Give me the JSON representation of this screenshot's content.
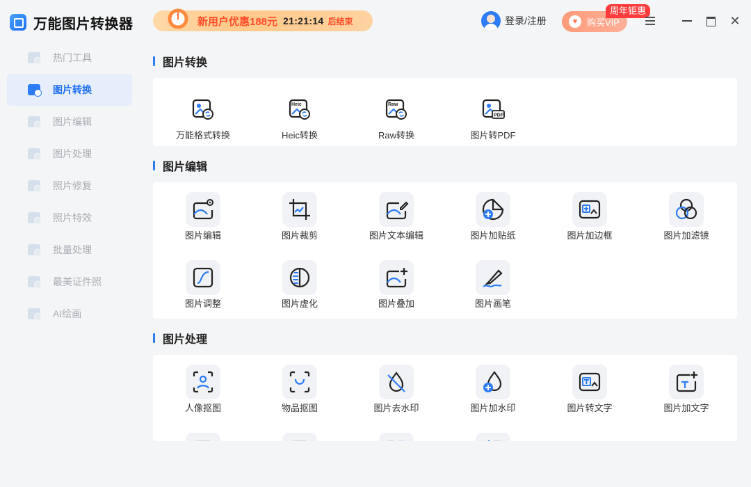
{
  "app": {
    "title": "万能图片转换器",
    "logo_icon": "app-logo-icon"
  },
  "sidebar": {
    "items": [
      {
        "label": "热门工具",
        "icon": "hot-tools-icon",
        "active": false
      },
      {
        "label": "图片转换",
        "icon": "image-convert-icon",
        "active": true
      },
      {
        "label": "图片编辑",
        "icon": "image-edit-icon",
        "active": false
      },
      {
        "label": "图片处理",
        "icon": "image-process-icon",
        "active": false
      },
      {
        "label": "照片修复",
        "icon": "photo-repair-icon",
        "active": false
      },
      {
        "label": "照片特效",
        "icon": "photo-effects-icon",
        "active": false
      },
      {
        "label": "批量处理",
        "icon": "batch-process-icon",
        "active": false
      },
      {
        "label": "最美证件照",
        "icon": "id-photo-icon",
        "active": false
      },
      {
        "label": "AI绘画",
        "icon": "ai-painting-icon",
        "active": false
      }
    ]
  },
  "header": {
    "promo": {
      "text": "新用户优惠188元",
      "timer": "21:21:14",
      "suffix": "后结束"
    },
    "login": "登录/注册",
    "vip": {
      "label": "购买VIP",
      "badge": "周年钜惠"
    },
    "accent": "#2d7cf6"
  },
  "sections": {
    "convert": {
      "title": "图片转换",
      "tools": [
        "万能格式转换",
        "Heic转换",
        "Raw转换",
        "图片转PDF"
      ]
    },
    "edit": {
      "title": "图片编辑",
      "tools": [
        "图片编辑",
        "图片裁剪",
        "图片文本编辑",
        "图片加贴纸",
        "图片加边框",
        "图片加滤镜",
        "图片调整",
        "图片虚化",
        "图片叠加",
        "图片画笔"
      ]
    },
    "process": {
      "title": "图片处理",
      "tools": [
        "人像抠图",
        "物品抠图",
        "图片去水印",
        "图片加水印",
        "图片转文字",
        "图片加文字"
      ]
    }
  }
}
